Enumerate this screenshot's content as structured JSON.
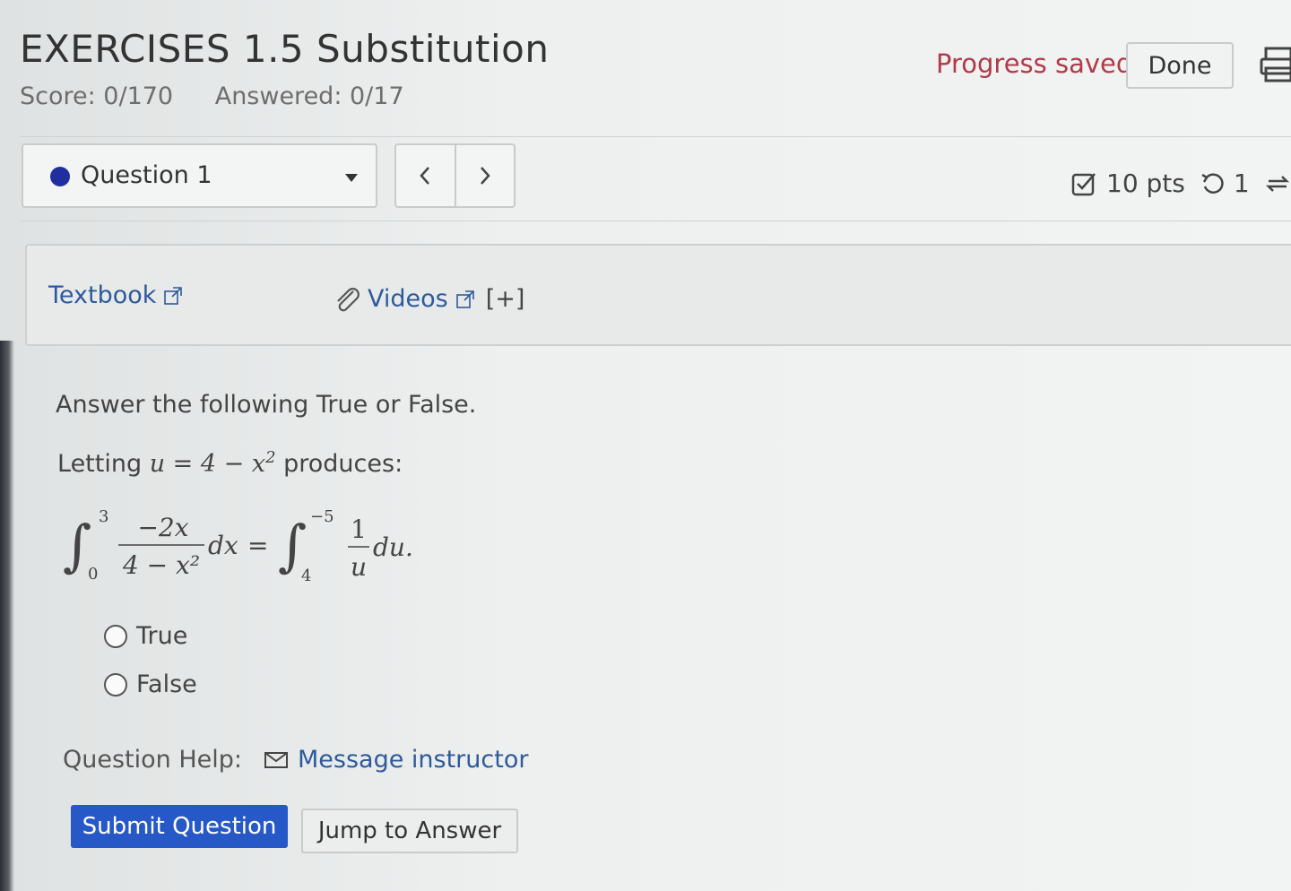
{
  "header": {
    "title": "EXERCISES 1.5 Substitution",
    "score": "Score: 0/170",
    "answered": "Answered: 0/17",
    "progress_status": "Progress saved",
    "done_label": "Done"
  },
  "question_nav": {
    "selected_question": "Question 1",
    "prev_glyph": "<",
    "next_glyph": ">"
  },
  "meta": {
    "points": "10 pts",
    "attempts": "1"
  },
  "resources": {
    "textbook_label": "Textbook",
    "videos_label": "Videos",
    "expand_label": "[+]"
  },
  "question": {
    "instruction": "Answer the following True or False.",
    "letting_prefix": "Letting",
    "substitution": "u = 4 − x",
    "substitution_exp": "2",
    "letting_suffix": "produces:",
    "lhs_upper": "3",
    "lhs_lower": "0",
    "lhs_num": "−2x",
    "lhs_den": "4 − x²",
    "lhs_diff": "dx",
    "equals": "=",
    "rhs_upper": "−5",
    "rhs_lower": "4",
    "rhs_num": "1",
    "rhs_den": "u",
    "rhs_diff": "du."
  },
  "options": [
    {
      "label": "True"
    },
    {
      "label": "False"
    }
  ],
  "help": {
    "label": "Question Help:",
    "message_label": "Message instructor"
  },
  "actions": {
    "submit_label": "Submit Question",
    "jump_label": "Jump to Answer"
  }
}
